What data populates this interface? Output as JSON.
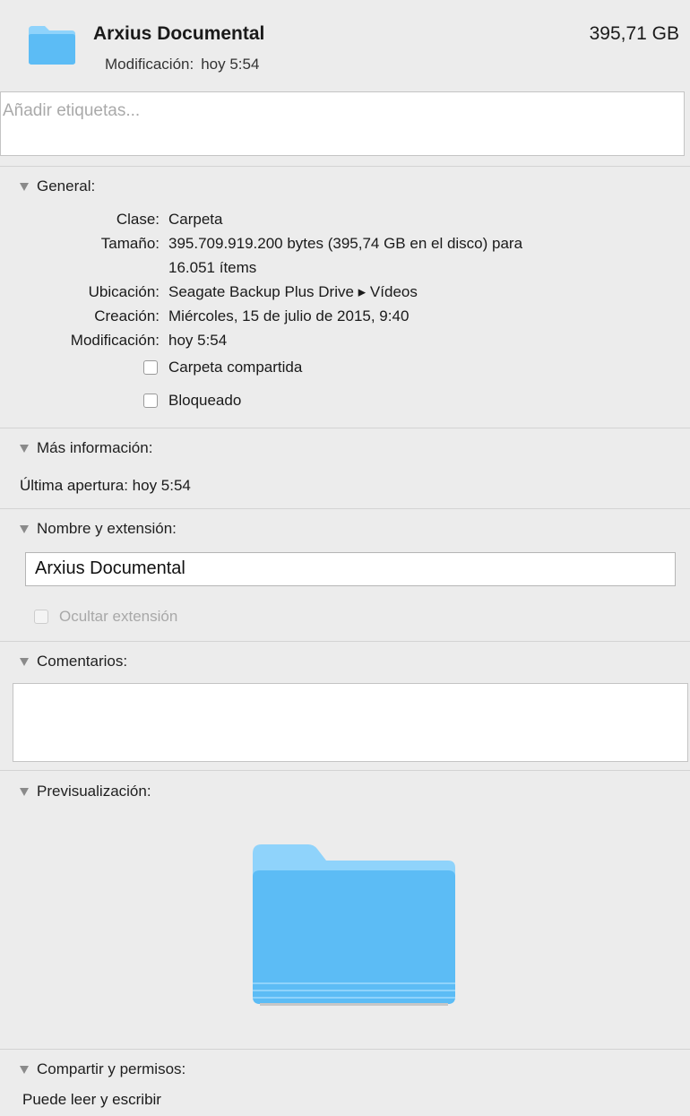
{
  "header": {
    "name": "Arxius Documental",
    "size": "395,71 GB",
    "modified_label": "Modificación:",
    "modified_value": "hoy 5:54"
  },
  "tags": {
    "placeholder": "Añadir etiquetas..."
  },
  "general": {
    "title": "General:",
    "rows": [
      {
        "label": "Clase:",
        "value": "Carpeta"
      },
      {
        "label": "Tamaño:",
        "value": "395.709.919.200 bytes (395,74 GB en el disco) para",
        "value2": "16.051 ítems"
      },
      {
        "label": "Ubicación:",
        "value": "Seagate Backup Plus Drive ▸ Vídeos"
      },
      {
        "label": "Creación:",
        "value": "Miércoles, 15 de julio de 2015, 9:40"
      },
      {
        "label": "Modificación:",
        "value": "hoy 5:54"
      }
    ],
    "shared_folder": "Carpeta compartida",
    "locked": "Bloqueado"
  },
  "more_info": {
    "title": "Más información:",
    "last_opened": "Última apertura: hoy 5:54"
  },
  "name_ext": {
    "title": "Nombre y extensión:",
    "value": "Arxius Documental",
    "hide_ext": "Ocultar extensión"
  },
  "comments": {
    "title": "Comentarios:"
  },
  "preview": {
    "title": "Previsualización:"
  },
  "sharing": {
    "title": "Compartir y permisos:",
    "permission": "Puede leer y escribir"
  },
  "colors": {
    "folder_light": "#8fd3fb",
    "folder_main": "#5cbcf5",
    "background": "#ececec"
  },
  "icons": {
    "header": "folder-icon",
    "preview": "folder-icon",
    "disclosure": "disclosure-triangle-icon"
  }
}
